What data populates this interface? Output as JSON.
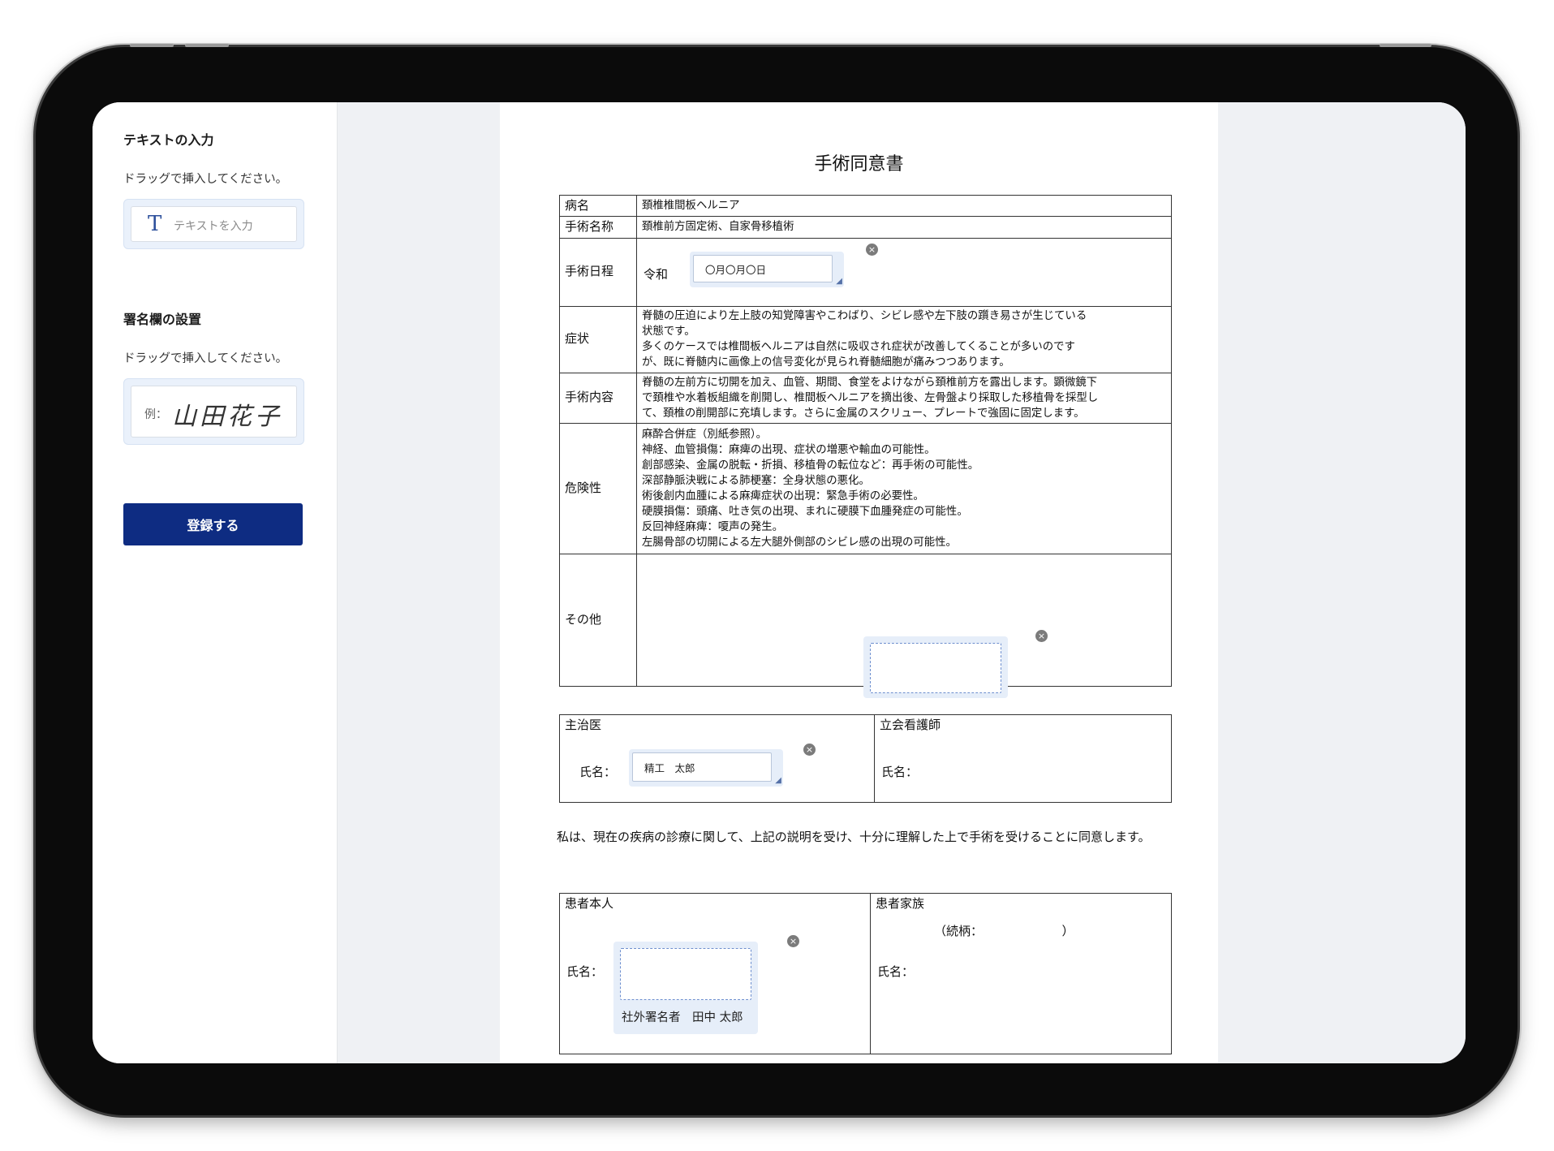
{
  "sidebar": {
    "text_section_title": "テキストの入力",
    "text_hint": "ドラッグで挿入してください。",
    "text_tool_label": "テキストを入力",
    "signature_section_title": "署名欄の設置",
    "signature_hint": "ドラッグで挿入してください。",
    "signature_example_prefix": "例：",
    "signature_example_name": "山田花子",
    "register_button": "登録する"
  },
  "document": {
    "title": "手術同意書",
    "rows": [
      {
        "label": "病名",
        "value": "頚椎椎間板ヘルニア"
      },
      {
        "label": "手術名称",
        "value": "頚椎前方固定術、自家骨移植術"
      },
      {
        "label": "手術日程",
        "prefix": "令和",
        "date_value": "〇月〇月〇日"
      },
      {
        "label": "症状",
        "lines": [
          "脊髄の圧迫により左上肢の知覚障害やこわばり、シビレ感や左下肢の躓き易さが生じている",
          "状態です。",
          "多くのケースでは椎間板ヘルニアは自然に吸収され症状が改善してくることが多いのです",
          "が、既に脊髄内に画像上の信号変化が見られ脊髄細胞が痛みつつあります。"
        ]
      },
      {
        "label": "手術内容",
        "lines": [
          "脊髄の左前方に切開を加え、血管、期間、食堂をよけながら頚椎前方を露出します。顕微鏡下",
          "で頚椎や水着板組織を削開し、椎間板ヘルニアを摘出後、左骨盤より採取した移植骨を採型し",
          "て、頚椎の削開部に充填します。さらに金属のスクリュー、プレートで強固に固定します。"
        ]
      },
      {
        "label": "危険性",
        "lines": [
          "麻酔合併症（別紙参照）。",
          "神経、血管損傷：麻痺の出現、症状の増悪や輸血の可能性。",
          "創部感染、金属の脱転・折損、移植骨の転位など：再手術の可能性。",
          "深部静脈決戦による肺梗塞：全身状態の悪化。",
          "術後創内血腫による麻痺症状の出現：緊急手術の必要性。",
          "硬膜損傷：頭痛、吐き気の出現、まれに硬膜下血腫発症の可能性。",
          "反回神経麻痺：嗄声の発生。",
          "左腸骨部の切開による左大腿外側部のシビレ感の出現の可能性。"
        ]
      },
      {
        "label": "その他",
        "lines": []
      }
    ],
    "doctor_section": {
      "attending_label": "主治医",
      "name_label": "氏名：",
      "attending_name_value": "精工　太郎",
      "nurse_label": "立会看護師",
      "nurse_name_label": "氏名："
    },
    "consent_text": "私は、現在の疾病の診療に関して、上記の説明を受け、十分に理解した上で手術を受けることに同意します。",
    "patient_section": {
      "patient_label": "患者本人",
      "name_label": "氏名：",
      "family_label": "患者家族",
      "relation_label": "（続柄：　　　　　　　）",
      "family_name_label": "氏名：",
      "external_signer_caption": "社外署名者　田中 太郎"
    }
  },
  "colors": {
    "primary_button": "#0e2c82",
    "viewer_background": "#eff1f4",
    "field_highlight": "#e6eef9",
    "dashed_border": "#6d8fcf"
  },
  "icons": {
    "text_tool": "T",
    "remove_field": "×",
    "resize_handle": "◢"
  }
}
